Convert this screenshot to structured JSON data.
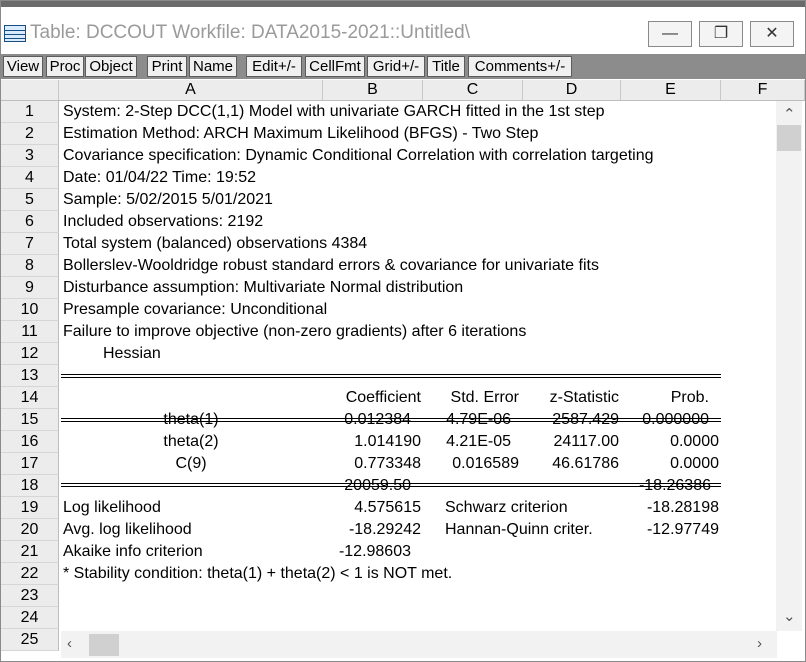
{
  "window": {
    "title": "Table: DCCOUT   Workfile: DATA2015-2021::Untitled\\",
    "minimize_glyph": "—",
    "restore_glyph": "❐",
    "close_glyph": "✕"
  },
  "toolbar": {
    "buttons": [
      "View",
      "Proc",
      "Object",
      "Print",
      "Name",
      "Edit+/-",
      "CellFmt",
      "Grid+/-",
      "Title",
      "Comments+/-"
    ]
  },
  "columns": [
    "A",
    "B",
    "C",
    "D",
    "E",
    "F"
  ],
  "rows": {
    "numbers": [
      "1",
      "2",
      "3",
      "4",
      "5",
      "6",
      "7",
      "8",
      "9",
      "10",
      "11",
      "12",
      "13",
      "14",
      "15",
      "16",
      "17",
      "18",
      "19",
      "20",
      "21",
      "22",
      "23",
      "24",
      "25"
    ]
  },
  "header_lines": [
    "System: 2-Step DCC(1,1) Model with univariate GARCH fitted in the 1st step",
    "Estimation Method: ARCH Maximum Likelihood (BFGS) - Two Step",
    "Covariance specification: Dynamic Conditional Correlation with correlation targeting",
    "Date: 01/04/22   Time: 19:52",
    "Sample: 5/02/2015 5/01/2021",
    "Included observations: 2192",
    "Total system (balanced) observations 4384",
    "Bollerslev-Wooldridge robust standard errors & covariance for univariate fits",
    "Disturbance assumption: Multivariate Normal distribution",
    "Presample covariance: Unconditional",
    "Failure to improve objective (non-zero gradients) after 6 iterations",
    "Hessian"
  ],
  "coef_table": {
    "headers": {
      "coefficient": "Coefficient",
      "std_error": "Std. Error",
      "z_stat": "z-Statistic",
      "prob": "Prob."
    },
    "rows": [
      {
        "name": "theta(1)",
        "coef": "0.012384",
        "se": "4.79E-06",
        "z": "2587.429",
        "p": "0.000000"
      },
      {
        "name": "theta(2)",
        "coef": "1.014190",
        "se": "4.21E-05",
        "z": "24117.00",
        "p": "0.0000"
      },
      {
        "name": "C(9)",
        "coef": "0.773348",
        "se": "0.016589",
        "z": "46.61786",
        "p": "0.0000"
      }
    ],
    "row18": {
      "b": "20059.50",
      "e": "-18.26386"
    }
  },
  "stats": {
    "log_likelihood_label": "Log likelihood",
    "log_likelihood": "4.575615",
    "schwarz_label": "Schwarz criterion",
    "schwarz": "-18.28198",
    "avg_log_label": "Avg. log likelihood",
    "avg_log": "-18.29242",
    "hq_label": "Hannan-Quinn criter.",
    "hq": "-12.97749",
    "aic_label": "Akaike info criterion",
    "aic": "-12.98603"
  },
  "stability_note": "* Stability condition: theta(1) + theta(2) < 1 is NOT met."
}
